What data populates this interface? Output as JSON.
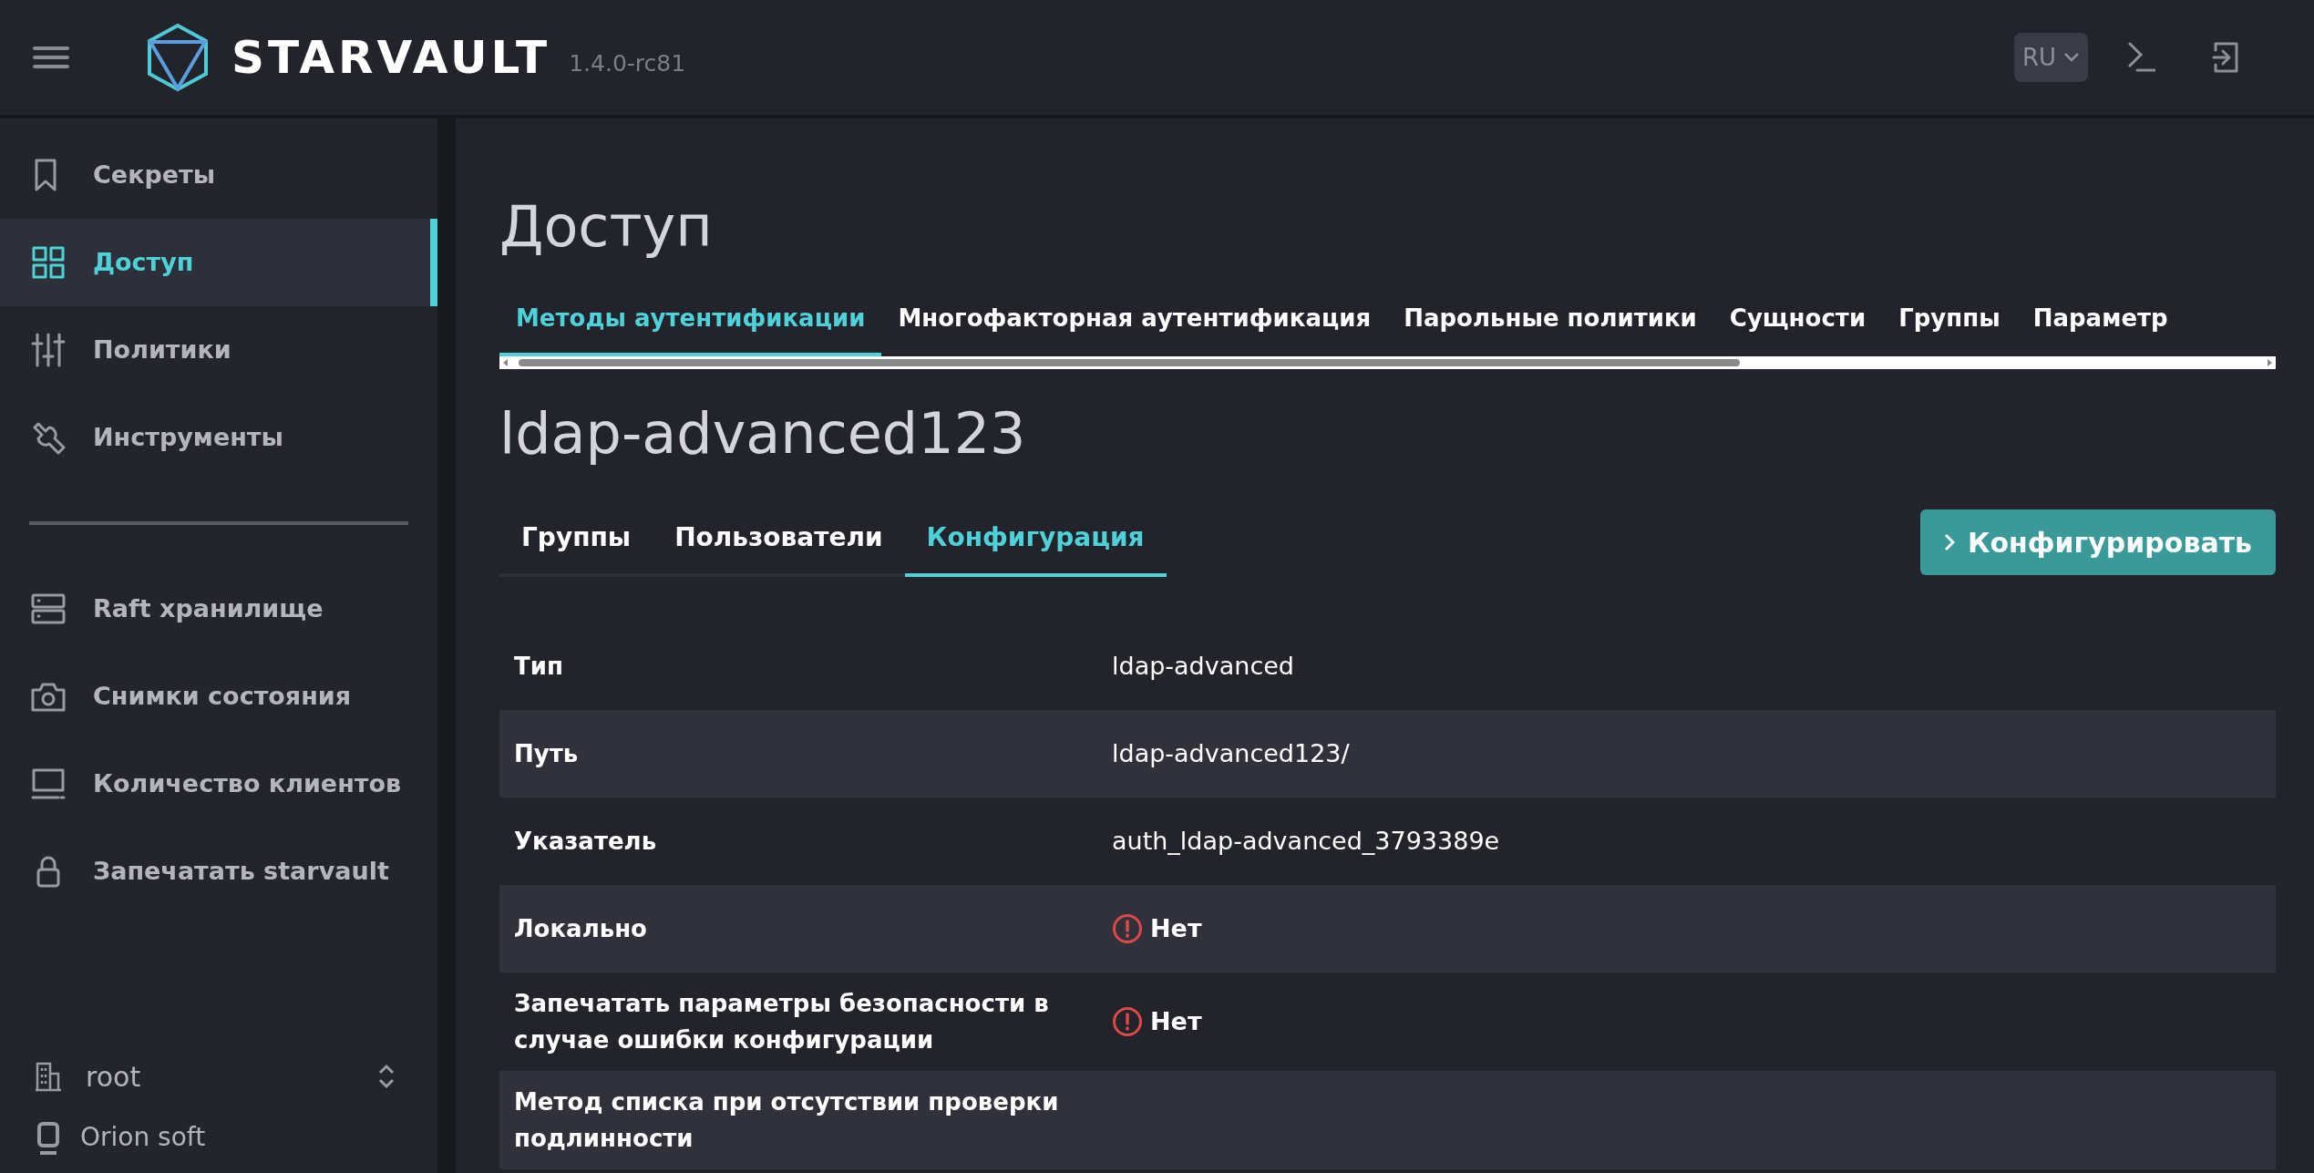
{
  "header": {
    "logo_text": "STARVAULT",
    "version": "1.4.0-rc81",
    "language": "RU"
  },
  "sidebar": {
    "items": [
      {
        "label": "Секреты",
        "selected": false
      },
      {
        "label": "Доступ",
        "selected": true
      },
      {
        "label": "Политики",
        "selected": false
      },
      {
        "label": "Инструменты",
        "selected": false
      }
    ],
    "secondary_items": [
      {
        "label": "Raft хранилище",
        "selected": false
      },
      {
        "label": "Снимки состояния",
        "selected": false
      },
      {
        "label": "Количество клиентов",
        "selected": false
      },
      {
        "label": "Запечатать starvault",
        "selected": false
      }
    ],
    "namespace": "root",
    "organization": "Orion soft"
  },
  "page_title": "Доступ",
  "tabs": [
    {
      "label": "Методы аутентификации",
      "selected": true
    },
    {
      "label": "Многофакторная аутентификация",
      "selected": false
    },
    {
      "label": "Парольные политики",
      "selected": false
    },
    {
      "label": "Сущности",
      "selected": false
    },
    {
      "label": "Группы",
      "selected": false
    },
    {
      "label": "Параметр",
      "selected": false
    }
  ],
  "mount_title": "ldap-advanced123",
  "subtabs": [
    {
      "label": "Группы",
      "selected": false
    },
    {
      "label": "Пользователи",
      "selected": false
    },
    {
      "label": "Конфигурация",
      "selected": true
    }
  ],
  "configure_button": "Конфигурировать",
  "table": {
    "rows": [
      {
        "label": "Тип",
        "kind": "text",
        "value": "ldap-advanced"
      },
      {
        "label": "Путь",
        "kind": "text",
        "value": "ldap-advanced123/"
      },
      {
        "label": "Указатель",
        "kind": "text",
        "value": "auth_ldap-advanced_3793389e"
      },
      {
        "label": "Локально",
        "kind": "negative",
        "value": "Нет"
      },
      {
        "label": "Запечатать параметры безопасности в случае ошибки конфигурации",
        "kind": "negative",
        "value": "Нет"
      },
      {
        "label": "Метод списка при отсутствии проверки подлинности",
        "kind": "empty"
      }
    ]
  }
}
